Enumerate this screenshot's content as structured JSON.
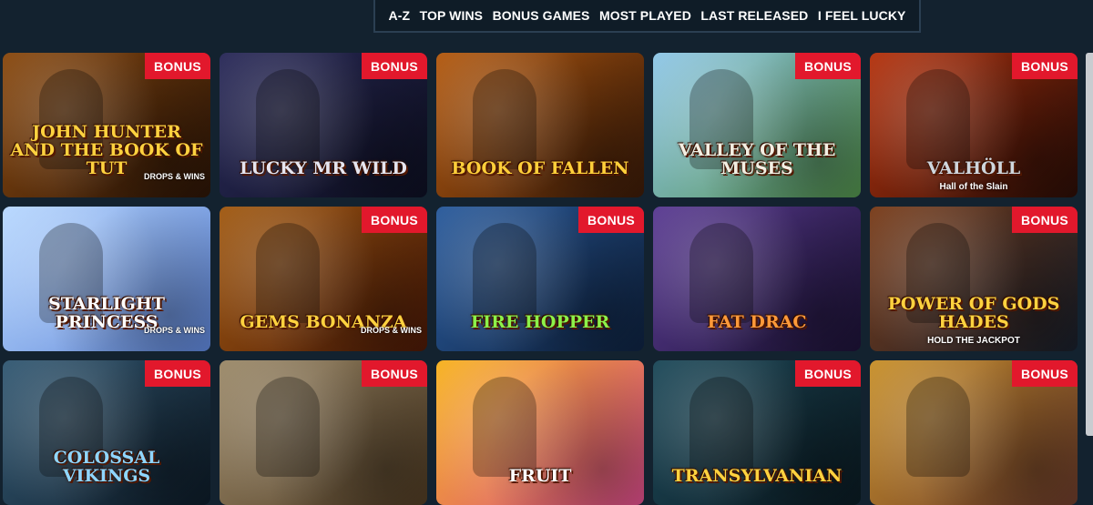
{
  "filters": [
    "A-Z",
    "TOP WINS",
    "BONUS GAMES",
    "MOST PLAYED",
    "LAST RELEASED",
    "I FEEL LUCKY"
  ],
  "badge_label": "BONUS",
  "drops_wins": "DROPS & WINS",
  "games": [
    {
      "title": "John Hunter and the Book of Tut",
      "subtitle": "",
      "bonus": true,
      "dw": true,
      "c1": "#8a4a10",
      "c2": "#2b1406",
      "t": "#ffd23f"
    },
    {
      "title": "Lucky Mr Wild",
      "subtitle": "",
      "bonus": true,
      "dw": false,
      "c1": "#2b2b5a",
      "c2": "#0d0f22",
      "t": "#e5e5f0"
    },
    {
      "title": "Book of Fallen",
      "subtitle": "",
      "bonus": false,
      "dw": false,
      "c1": "#b35a10",
      "c2": "#3a1a08",
      "t": "#ffcf3a"
    },
    {
      "title": "Valley of the Muses",
      "subtitle": "",
      "bonus": true,
      "dw": false,
      "c1": "#8fc7e8",
      "c2": "#4f8d49",
      "t": "#f3efe3"
    },
    {
      "title": "Valhöll",
      "subtitle": "Hall of the Slain",
      "bonus": true,
      "dw": false,
      "c1": "#b5330e",
      "c2": "#2a0d06",
      "t": "#cfd6dd"
    },
    {
      "title": "Starlight Princess",
      "subtitle": "",
      "bonus": false,
      "dw": true,
      "c1": "#b8d8ff",
      "c2": "#5c83d6",
      "t": "#ffffff"
    },
    {
      "title": "Gems Bonanza",
      "subtitle": "",
      "bonus": true,
      "dw": true,
      "c1": "#a15a12",
      "c2": "#4a1806",
      "t": "#ffd23f"
    },
    {
      "title": "Fire Hopper",
      "subtitle": "",
      "bonus": true,
      "dw": false,
      "c1": "#2a5b9c",
      "c2": "#0e2240",
      "t": "#8cf24a"
    },
    {
      "title": "Fat Drac",
      "subtitle": "",
      "bonus": false,
      "dw": false,
      "c1": "#5b3c93",
      "c2": "#1c1236",
      "t": "#ff9a3a"
    },
    {
      "title": "Power of Gods Hades",
      "subtitle": "HOLD THE JACKPOT",
      "bonus": true,
      "dw": false,
      "c1": "#7a3d1a",
      "c2": "#171e2a",
      "t": "#ffd23f"
    },
    {
      "title": "Colossal Vikings",
      "subtitle": "",
      "bonus": true,
      "dw": false,
      "c1": "#345a74",
      "c2": "#0d1b28",
      "t": "#8fd6ff"
    },
    {
      "title": "",
      "subtitle": "",
      "bonus": true,
      "dw": false,
      "c1": "#9c8a6a",
      "c2": "#4e3a22",
      "t": "#ffd23f"
    },
    {
      "title": "Fruit",
      "subtitle": "",
      "bonus": false,
      "dw": false,
      "c1": "#f7b21e",
      "c2": "#d94b8a",
      "t": "#ffffff"
    },
    {
      "title": "Transylvanian",
      "subtitle": "",
      "bonus": true,
      "dw": false,
      "c1": "#1e4a5a",
      "c2": "#0a1a22",
      "t": "#ffd23f"
    },
    {
      "title": "",
      "subtitle": "",
      "bonus": true,
      "dw": false,
      "c1": "#c8902a",
      "c2": "#6a3a2a",
      "t": "#ffd23f"
    }
  ]
}
